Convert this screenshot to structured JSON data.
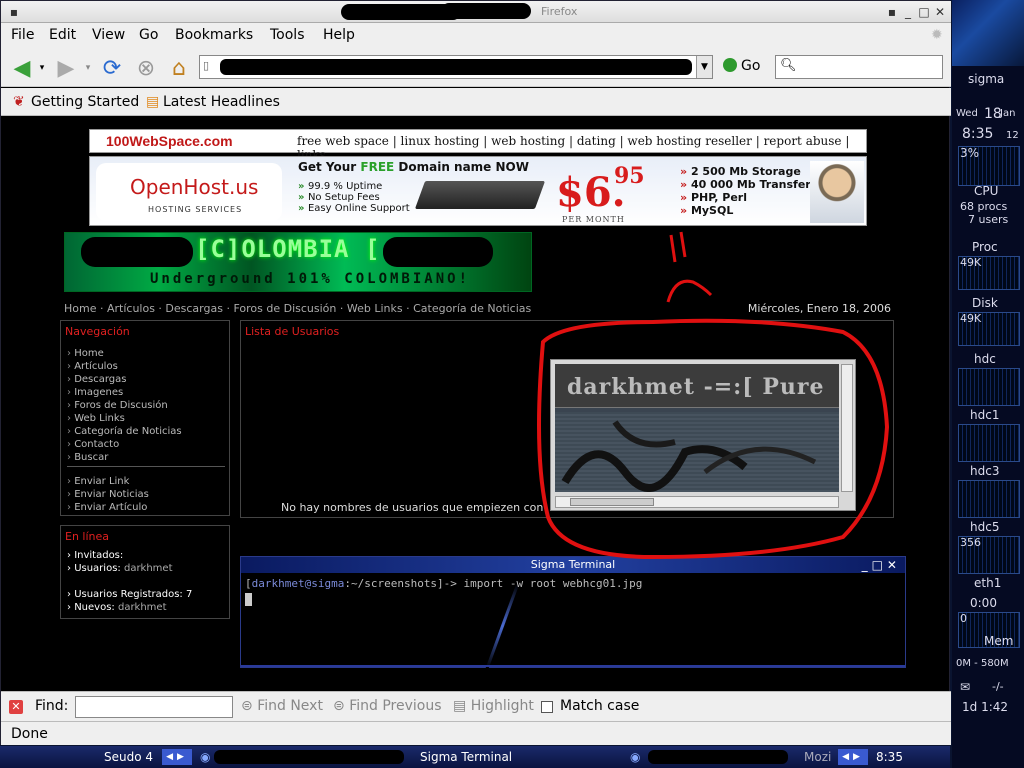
{
  "window": {
    "title_suffix": "Firefox",
    "minimize": "_",
    "maximize": "□",
    "close": "✕"
  },
  "menu": [
    "File",
    "Edit",
    "View",
    "Go",
    "Bookmarks",
    "Tools",
    "Help"
  ],
  "toolbar": {
    "back_icon": "back-arrow-icon",
    "forward_icon": "forward-arrow-icon",
    "reload_icon": "reload-icon",
    "stop_icon": "stop-icon",
    "home_icon": "home-icon",
    "go_label": "Go"
  },
  "bookmarks": [
    "Getting Started",
    "Latest Headlines"
  ],
  "page": {
    "top_ad": {
      "brand": "100WebSpace.com",
      "links": "free web space | linux hosting | web hosting | dating | web hosting reseller | report abuse | links"
    },
    "banner": {
      "logo": "OpenHost.us",
      "logo_sub": "HOSTING SERVICES",
      "headline_pre": "Get Your ",
      "headline_free": "FREE",
      "headline_post": " Domain name NOW",
      "bullets": [
        "99.9 % Uptime",
        "No Setup Fees",
        "Easy Online Support"
      ],
      "price_dollars": "$6.",
      "price_cents": "95",
      "price_period": "PER MONTH",
      "features": [
        "2 500 Mb Storage",
        "40 000 Mb Transfer",
        "PHP, Perl",
        "MySQL"
      ]
    },
    "site_logo": {
      "title": "[C]OLOMBIA [",
      "subtitle": "Underground 101% COLOMBIANO!"
    },
    "breadcrumb": "Home · Artículos · Descargas · Foros de Discusión · Web Links · Categoría de Noticias",
    "date": "Miércoles, Enero 18, 2006",
    "nav_panel": {
      "title": "Navegación",
      "items": [
        "Home",
        "Artículos",
        "Descargas",
        "Imagenes",
        "Foros de Discusión",
        "Web Links",
        "Categoría de Noticias",
        "Contacto",
        "Buscar"
      ],
      "items2": [
        "Enviar Link",
        "Enviar Noticias",
        "Enviar Artículo"
      ]
    },
    "online_panel": {
      "title": "En línea",
      "guests_label": "Invitados:",
      "users_label": "Usuarios:",
      "users_value": "darkhmet",
      "registered_label": "Usuarios Registrados:",
      "registered_value": "7",
      "new_label": "Nuevos:",
      "new_value": "darkhmet"
    },
    "users_panel": {
      "title": "Lista de Usuarios",
      "message": "No hay nombres de usuarios que empiezen con"
    },
    "embedded_shot": {
      "text": "darkhmet -=:[ Pure"
    },
    "terminal": {
      "title": "Sigma Terminal",
      "prompt_user": "darkhmet@sigma",
      "prompt_path": ":~/screenshots]->",
      "prompt_open": "[",
      "command": " import -w root webhcg01.jpg"
    },
    "annotation_color": "#e01010"
  },
  "findbar": {
    "label": "Find:",
    "value": "",
    "find_next": "Find Next",
    "find_previous": "Find Previous",
    "highlight": "Highlight",
    "match_case": "Match case"
  },
  "status": "Done",
  "taskbar": {
    "desktop": "Seudo 4",
    "terminal": "Sigma Terminal",
    "mozi": "Mozi",
    "time": "8:35"
  },
  "sidepanel": {
    "host": "sigma",
    "day": "Wed",
    "date": "18",
    "month": "Jan",
    "time": "8:35",
    "seconds": "12",
    "cpu_pct": "3%",
    "cpu_label": "CPU",
    "procs": "68 procs",
    "users": "7 users",
    "proc_label": "Proc",
    "proc_val": "49K",
    "disk_label": "Disk",
    "disk_val": "49K",
    "hdc": "hdc",
    "hdc1": "hdc1",
    "hdc3": "hdc3",
    "hdc5": "hdc5",
    "hdc5_val": "356",
    "eth": "eth1",
    "eth_time": "0:00",
    "eth_val": "0",
    "mem": "Mem",
    "mem_val": "0M - 580M",
    "mail": "-/-",
    "uptime": "1d 1:42"
  }
}
